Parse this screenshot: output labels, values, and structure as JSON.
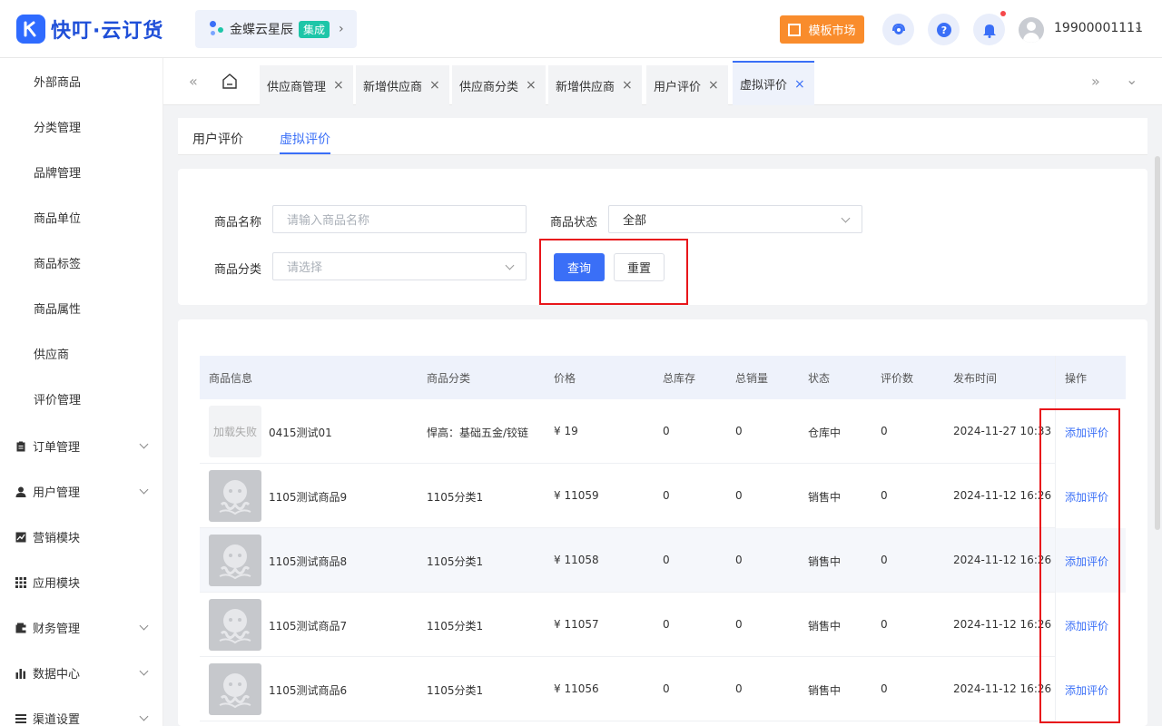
{
  "app": {
    "brand": "快叮·云订货",
    "kingdee_label": "金蝶云星辰",
    "kingdee_badge": "集成",
    "template_market": "模板市场",
    "user": "19900001111",
    "brand_color": "#2f6bff",
    "accent_color": "#3a6ff7",
    "orange": "#f98c2c",
    "highlight_color": "#e8161b"
  },
  "sidebar": {
    "sub_items": [
      "外部商品",
      "分类管理",
      "品牌管理",
      "商品单位",
      "商品标签",
      "商品属性",
      "供应商",
      "评价管理"
    ],
    "groups": [
      {
        "label": "订单管理",
        "icon": "clipboard-icon",
        "has_chevron": true
      },
      {
        "label": "用户管理",
        "icon": "user-icon",
        "has_chevron": true
      },
      {
        "label": "营销模块",
        "icon": "chart-line-icon",
        "has_chevron": false
      },
      {
        "label": "应用模块",
        "icon": "grid-icon",
        "has_chevron": false
      },
      {
        "label": "财务管理",
        "icon": "wallet-icon",
        "has_chevron": true
      },
      {
        "label": "数据中心",
        "icon": "bar-chart-icon",
        "has_chevron": true
      },
      {
        "label": "渠道设置",
        "icon": "list-icon",
        "has_chevron": true
      }
    ]
  },
  "page_tabs": [
    {
      "label": "供应商管理",
      "active": false
    },
    {
      "label": "新增供应商",
      "active": false
    },
    {
      "label": "供应商分类",
      "active": false
    },
    {
      "label": "新增供应商",
      "active": false
    },
    {
      "label": "用户评价",
      "active": false
    },
    {
      "label": "虚拟评价",
      "active": true
    }
  ],
  "content_tabs": [
    {
      "label": "用户评价",
      "active": false
    },
    {
      "label": "虚拟评价",
      "active": true
    }
  ],
  "filters": {
    "name_label": "商品名称",
    "name_placeholder": "请输入商品名称",
    "status_label": "商品状态",
    "status_value": "全部",
    "category_label": "商品分类",
    "category_placeholder": "请选择",
    "query_button": "查询",
    "reset_button": "重置"
  },
  "table": {
    "columns": [
      "商品信息",
      "商品分类",
      "价格",
      "总库存",
      "总销量",
      "状态",
      "评价数",
      "发布时间",
      "操作"
    ],
    "rows": [
      {
        "image": "加载失败",
        "name": "0415测试01",
        "category": "悍高：基础五金/铰链",
        "price": "¥ 19",
        "stock": "0",
        "sales": "0",
        "status": "仓库中",
        "reviews": "0",
        "published": "2024-11-27 10:33",
        "action": "添加评价"
      },
      {
        "image": "",
        "name": "1105测试商品9",
        "category": "1105分类1",
        "price": "¥ 11059",
        "stock": "0",
        "sales": "0",
        "status": "销售中",
        "reviews": "0",
        "published": "2024-11-12 16:26",
        "action": "添加评价"
      },
      {
        "image": "",
        "name": "1105测试商品8",
        "category": "1105分类1",
        "price": "¥ 11058",
        "stock": "0",
        "sales": "0",
        "status": "销售中",
        "reviews": "0",
        "published": "2024-11-12 16:26",
        "action": "添加评价"
      },
      {
        "image": "",
        "name": "1105测试商品7",
        "category": "1105分类1",
        "price": "¥ 11057",
        "stock": "0",
        "sales": "0",
        "status": "销售中",
        "reviews": "0",
        "published": "2024-11-12 16:26",
        "action": "添加评价"
      },
      {
        "image": "",
        "name": "1105测试商品6",
        "category": "1105分类1",
        "price": "¥ 11056",
        "stock": "0",
        "sales": "0",
        "status": "销售中",
        "reviews": "0",
        "published": "2024-11-12 16:26",
        "action": "添加评价"
      }
    ]
  }
}
